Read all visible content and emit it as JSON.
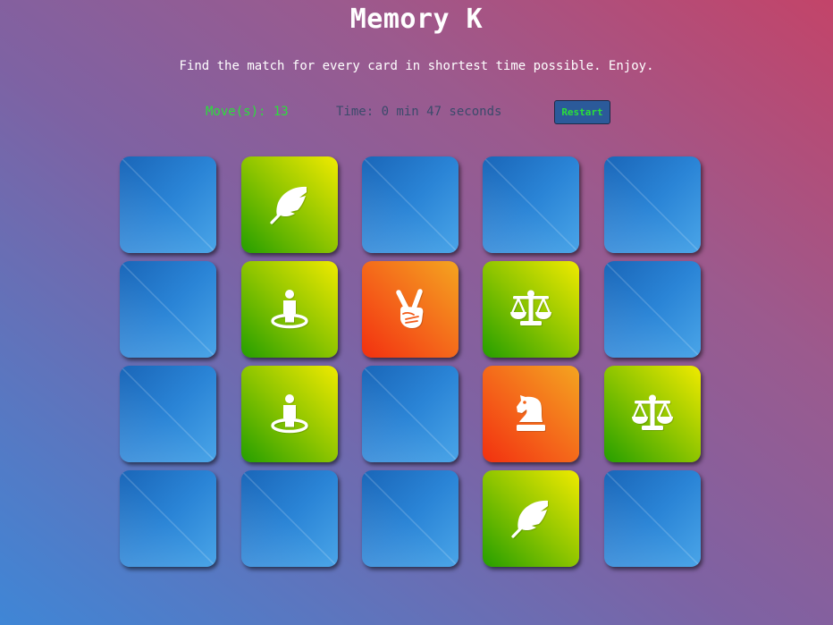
{
  "header": {
    "title": "Memory K",
    "subtitle": "Find the match for every card in shortest time possible. Enjoy."
  },
  "score_panel": {
    "moves_text": "Move(s): 13",
    "time_text": "Time: 0 min 47 seconds",
    "restart_label": "Restart"
  },
  "colors": {
    "moves": "#2bdf3a",
    "timer": "#3b4a6b",
    "card_closed": "#2a84d6",
    "card_open_from": "#249e00",
    "card_open_to": "#f0ea00",
    "card_match_from": "#f2300f",
    "card_match_to": "#f4a520"
  },
  "board": {
    "rows": 4,
    "cols": 5,
    "cards": [
      {
        "state": "closed",
        "icon": ""
      },
      {
        "state": "open",
        "icon": "feather-icon"
      },
      {
        "state": "closed",
        "icon": ""
      },
      {
        "state": "closed",
        "icon": ""
      },
      {
        "state": "closed",
        "icon": ""
      },
      {
        "state": "closed",
        "icon": ""
      },
      {
        "state": "open",
        "icon": "street-view-icon"
      },
      {
        "state": "matched",
        "icon": "hand-peace-icon"
      },
      {
        "state": "open",
        "icon": "balance-scale-icon"
      },
      {
        "state": "closed",
        "icon": ""
      },
      {
        "state": "closed",
        "icon": ""
      },
      {
        "state": "open",
        "icon": "street-view-icon"
      },
      {
        "state": "closed",
        "icon": ""
      },
      {
        "state": "matched",
        "icon": "chess-knight-icon"
      },
      {
        "state": "open",
        "icon": "balance-scale-icon"
      },
      {
        "state": "closed",
        "icon": ""
      },
      {
        "state": "closed",
        "icon": ""
      },
      {
        "state": "closed",
        "icon": ""
      },
      {
        "state": "open",
        "icon": "feather-icon"
      },
      {
        "state": "closed",
        "icon": ""
      }
    ]
  }
}
